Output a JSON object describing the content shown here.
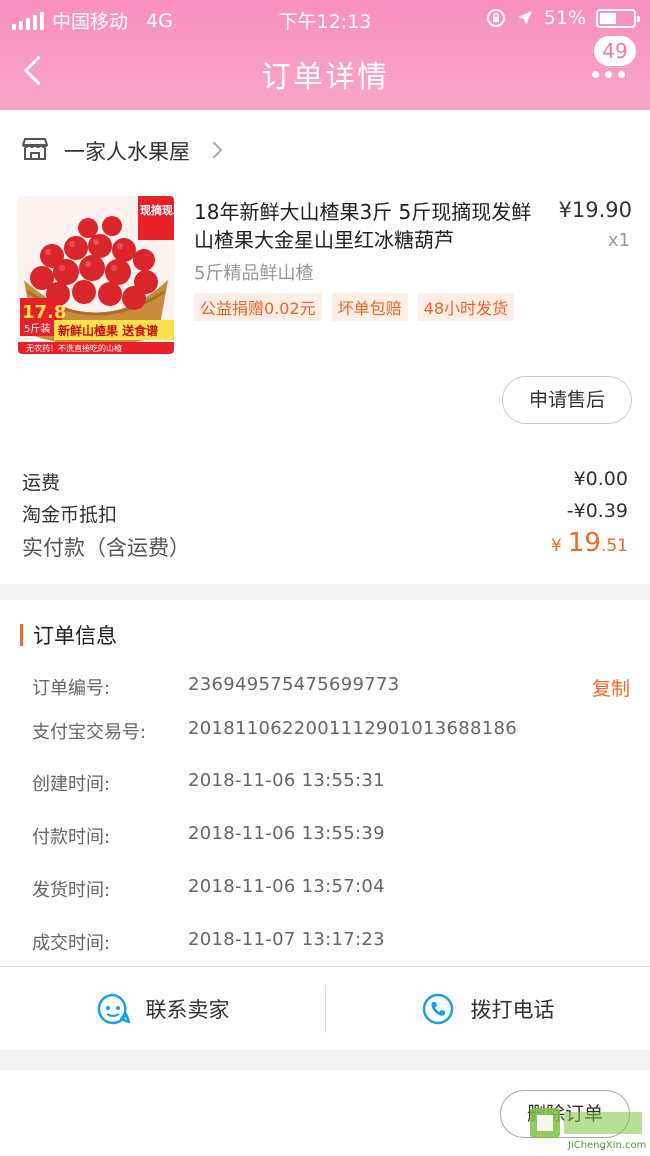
{
  "status_bar": {
    "carrier": "中国移动",
    "network": "4G",
    "time": "下午12:13",
    "battery": "51%"
  },
  "nav": {
    "title": "订单详情",
    "message_badge": "49"
  },
  "store": {
    "name": "一家人水果屋"
  },
  "product": {
    "title": "18年新鲜大山楂果3斤 5斤现摘现发鲜山楂果大金星山里红冰糖葫芦",
    "price": "¥19.90",
    "quantity": "x1",
    "sku": "5斤精品鲜山楂",
    "tags": [
      "公益捐赠0.02元",
      "坏单包赔",
      "48小时发货"
    ],
    "image": {
      "badge_top": "现摘现发",
      "badge_price": "17.8",
      "badge_unit": "5斤装",
      "banner": "新鲜山楂果 送食谱",
      "footer": "无农药！不洗直接吃的山楂"
    },
    "after_sale_label": "申请售后"
  },
  "fees": {
    "shipping_label": "运费",
    "shipping_value": "¥0.00",
    "coins_label": "淘金币抵扣",
    "coins_value": "-¥0.39",
    "total_label": "实付款（含运费）",
    "total_currency": "¥",
    "total_int": "19",
    "total_dec": ".51"
  },
  "order_info": {
    "heading": "订单信息",
    "copy_label": "复制",
    "rows": [
      {
        "label": "订单编号:",
        "value": "236949575475699773"
      },
      {
        "label": "支付宝交易号:",
        "value": "2018110622001112901013688186"
      },
      {
        "label": "创建时间:",
        "value": "2018-11-06 13:55:31"
      },
      {
        "label": "付款时间:",
        "value": "2018-11-06 13:55:39"
      },
      {
        "label": "发货时间:",
        "value": "2018-11-06 13:57:04"
      },
      {
        "label": "成交时间:",
        "value": "2018-11-07 13:17:23"
      }
    ]
  },
  "contact": {
    "seller_label": "联系卖家",
    "phone_label": "拨打电话"
  },
  "bottom": {
    "delete_label": "删除订单"
  },
  "watermark": {
    "text": "JiChengXin.com"
  },
  "colors": {
    "header_pink": "#f98fbd",
    "accent_orange": "#f26922",
    "contact_blue": "#1aa0e6"
  }
}
